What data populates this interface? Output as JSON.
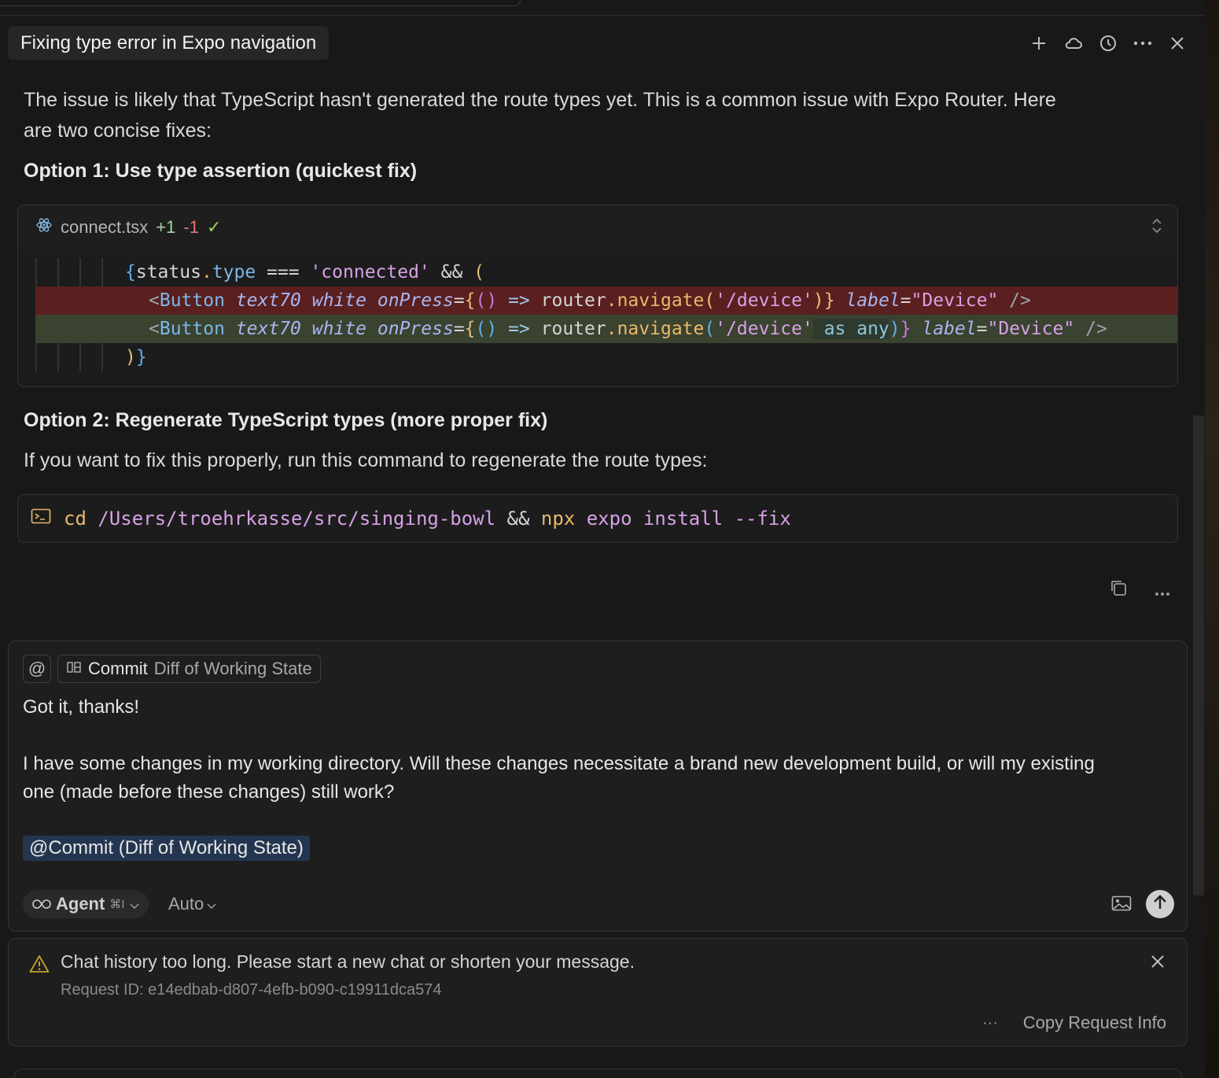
{
  "header": {
    "title": "Fixing type error in Expo navigation"
  },
  "header_icons": [
    "plus-icon",
    "cloud-icon",
    "history-icon",
    "more-icon",
    "close-icon"
  ],
  "response": {
    "intro_line1": "The issue is likely that TypeScript hasn't generated the route types yet. This is a common issue with Expo Router. Here",
    "intro_line2": "are two concise fixes:",
    "option1": "Option 1: Use type assertion (quickest fix)",
    "option2": "Option 2: Regenerate TypeScript types (more proper fix)",
    "option2_desc": "If you want to fix this properly, run this command to regenerate the route types:"
  },
  "code": {
    "filename": "connect.tsx",
    "added": "+1",
    "removed": "-1",
    "check": "✓",
    "lines": {
      "l1": {
        "brace": "{",
        "obj": "status",
        "dot": ".",
        "prop": "type",
        "op": " === ",
        "str": "'connected'",
        "and": " && ",
        "paren": "("
      },
      "del": {
        "lt": "<",
        "tag": "Button",
        "a1": "text70",
        "a2": "white",
        "a3": "onPress",
        "eq": "=",
        "b1": "{",
        "p1": "()",
        "arrow": " => ",
        "obj": "router",
        "dot": ".",
        "fn": "navigate",
        "p2": "(",
        "str": "'/device'",
        "p3": ")",
        "b2": "}",
        "a4": "label",
        "eq2": "=",
        "val": "\"Device\"",
        "close": " />"
      },
      "add": {
        "lt": "<",
        "tag": "Button",
        "a1": "text70",
        "a2": "white",
        "a3": "onPress",
        "eq": "=",
        "b1": "{",
        "p1": "()",
        "arrow": " => ",
        "obj": "router",
        "dot": ".",
        "fn": "navigate",
        "p2": "(",
        "str": "'/device'",
        "as": " as any",
        "p3": ")",
        "b2": "}",
        "a4": "label",
        "eq2": "=",
        "val": "\"Device\"",
        "close": " />"
      },
      "l4": {
        "p": ")",
        "b": "}"
      }
    }
  },
  "command": {
    "cd": "cd",
    "path": "/Users/troehrkasse/src/singing-bowl",
    "op": "&&",
    "npx": "npx",
    "expo": "expo",
    "install": "install",
    "flag": "--fix"
  },
  "composer": {
    "at": "@",
    "context_strong": "Commit",
    "context_dim": "Diff of Working State",
    "line1": "Got it, thanks!",
    "line2": "I have some changes in my working directory. Will these changes necessitate a brand new development build, or will my existing",
    "line3": "one (made before these changes) still work?",
    "mention": "@Commit (Diff of Working State)",
    "agent_label": "Agent",
    "agent_kbd": "⌘I",
    "model": "Auto"
  },
  "error": {
    "message": "Chat history too long. Please start a new chat or shorten your message.",
    "request_id": "Request ID: e14edbab-d807-4efb-b090-c19911dca574",
    "dots": "···",
    "copy": "Copy Request Info"
  }
}
